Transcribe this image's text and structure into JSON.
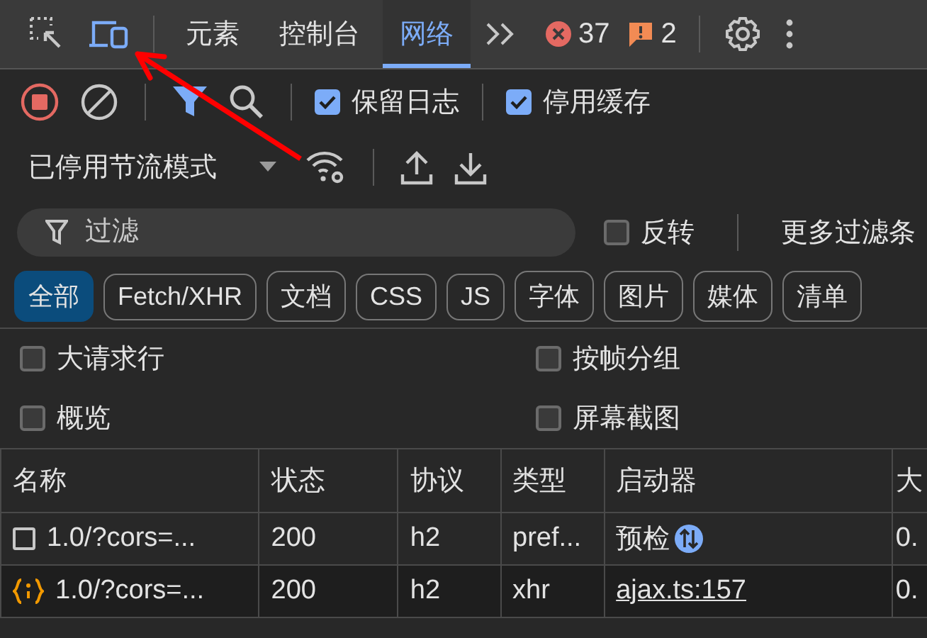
{
  "toolbar": {
    "tools": [
      {
        "kind": "inspect",
        "active": false
      },
      {
        "kind": "device",
        "active": true
      }
    ],
    "tabs": [
      {
        "label": "元素",
        "selected": false
      },
      {
        "label": "控制台",
        "selected": false
      },
      {
        "label": "网络",
        "selected": true
      }
    ],
    "errors": "37",
    "warnings": "2"
  },
  "controls": {
    "recording": true,
    "filter_active": true,
    "checkboxes": [
      {
        "label": "保留日志",
        "checked": true
      },
      {
        "label": "停用缓存",
        "checked": true
      }
    ],
    "throttle": "已停用节流模式"
  },
  "filter": {
    "placeholder": "过滤",
    "invert": {
      "label": "反转",
      "checked": false
    },
    "more": "更多过滤条"
  },
  "types": [
    {
      "label": "全部",
      "selected": true
    },
    {
      "label": "Fetch/XHR",
      "selected": false
    },
    {
      "label": "文档",
      "selected": false
    },
    {
      "label": "CSS",
      "selected": false
    },
    {
      "label": "JS",
      "selected": false
    },
    {
      "label": "字体",
      "selected": false
    },
    {
      "label": "图片",
      "selected": false
    },
    {
      "label": "媒体",
      "selected": false
    },
    {
      "label": "清单",
      "selected": false
    }
  ],
  "options": [
    {
      "label": "大请求行",
      "checked": false
    },
    {
      "label": "按帧分组",
      "checked": false
    },
    {
      "label": "概览",
      "checked": false
    },
    {
      "label": "屏幕截图",
      "checked": false
    }
  ],
  "table": {
    "columns": [
      "名称",
      "状态",
      "协议",
      "类型",
      "启动器",
      "大"
    ],
    "rows": [
      {
        "kind": "preflight",
        "name": "1.0/?cors=...",
        "status": "200",
        "protocol": "h2",
        "type": "pref...",
        "initiator": "预检",
        "size": "0."
      },
      {
        "kind": "xhr",
        "name": "1.0/?cors=...",
        "status": "200",
        "protocol": "h2",
        "type": "xhr",
        "initiator": "ajax.ts:157",
        "size": "0."
      }
    ]
  }
}
